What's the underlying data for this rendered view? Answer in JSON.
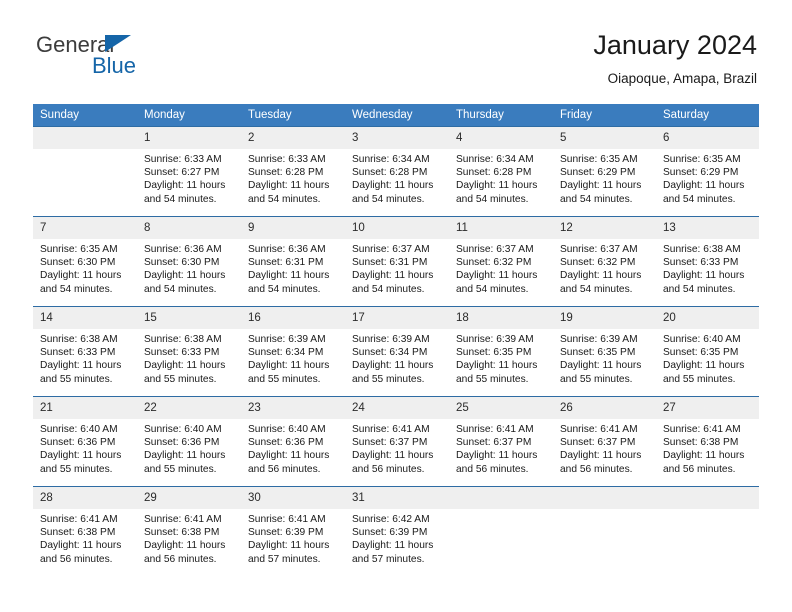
{
  "brand": {
    "name_part1": "General",
    "name_part2": "Blue",
    "logo_icon": "triangle-icon"
  },
  "header": {
    "title": "January 2024",
    "subtitle": "Oiapoque, Amapa, Brazil"
  },
  "calendar": {
    "weekday_headers": [
      "Sunday",
      "Monday",
      "Tuesday",
      "Wednesday",
      "Thursday",
      "Friday",
      "Saturday"
    ],
    "accent_color": "#3a7cbe",
    "daynum_bg_color": "#efefef",
    "row_border_color": "#2e6ca4",
    "weeks": [
      [
        {
          "day": "",
          "lines": []
        },
        {
          "day": "1",
          "lines": [
            "Sunrise: 6:33 AM",
            "Sunset: 6:27 PM",
            "Daylight: 11 hours and 54 minutes."
          ]
        },
        {
          "day": "2",
          "lines": [
            "Sunrise: 6:33 AM",
            "Sunset: 6:28 PM",
            "Daylight: 11 hours and 54 minutes."
          ]
        },
        {
          "day": "3",
          "lines": [
            "Sunrise: 6:34 AM",
            "Sunset: 6:28 PM",
            "Daylight: 11 hours and 54 minutes."
          ]
        },
        {
          "day": "4",
          "lines": [
            "Sunrise: 6:34 AM",
            "Sunset: 6:28 PM",
            "Daylight: 11 hours and 54 minutes."
          ]
        },
        {
          "day": "5",
          "lines": [
            "Sunrise: 6:35 AM",
            "Sunset: 6:29 PM",
            "Daylight: 11 hours and 54 minutes."
          ]
        },
        {
          "day": "6",
          "lines": [
            "Sunrise: 6:35 AM",
            "Sunset: 6:29 PM",
            "Daylight: 11 hours and 54 minutes."
          ]
        }
      ],
      [
        {
          "day": "7",
          "lines": [
            "Sunrise: 6:35 AM",
            "Sunset: 6:30 PM",
            "Daylight: 11 hours and 54 minutes."
          ]
        },
        {
          "day": "8",
          "lines": [
            "Sunrise: 6:36 AM",
            "Sunset: 6:30 PM",
            "Daylight: 11 hours and 54 minutes."
          ]
        },
        {
          "day": "9",
          "lines": [
            "Sunrise: 6:36 AM",
            "Sunset: 6:31 PM",
            "Daylight: 11 hours and 54 minutes."
          ]
        },
        {
          "day": "10",
          "lines": [
            "Sunrise: 6:37 AM",
            "Sunset: 6:31 PM",
            "Daylight: 11 hours and 54 minutes."
          ]
        },
        {
          "day": "11",
          "lines": [
            "Sunrise: 6:37 AM",
            "Sunset: 6:32 PM",
            "Daylight: 11 hours and 54 minutes."
          ]
        },
        {
          "day": "12",
          "lines": [
            "Sunrise: 6:37 AM",
            "Sunset: 6:32 PM",
            "Daylight: 11 hours and 54 minutes."
          ]
        },
        {
          "day": "13",
          "lines": [
            "Sunrise: 6:38 AM",
            "Sunset: 6:33 PM",
            "Daylight: 11 hours and 54 minutes."
          ]
        }
      ],
      [
        {
          "day": "14",
          "lines": [
            "Sunrise: 6:38 AM",
            "Sunset: 6:33 PM",
            "Daylight: 11 hours and 55 minutes."
          ]
        },
        {
          "day": "15",
          "lines": [
            "Sunrise: 6:38 AM",
            "Sunset: 6:33 PM",
            "Daylight: 11 hours and 55 minutes."
          ]
        },
        {
          "day": "16",
          "lines": [
            "Sunrise: 6:39 AM",
            "Sunset: 6:34 PM",
            "Daylight: 11 hours and 55 minutes."
          ]
        },
        {
          "day": "17",
          "lines": [
            "Sunrise: 6:39 AM",
            "Sunset: 6:34 PM",
            "Daylight: 11 hours and 55 minutes."
          ]
        },
        {
          "day": "18",
          "lines": [
            "Sunrise: 6:39 AM",
            "Sunset: 6:35 PM",
            "Daylight: 11 hours and 55 minutes."
          ]
        },
        {
          "day": "19",
          "lines": [
            "Sunrise: 6:39 AM",
            "Sunset: 6:35 PM",
            "Daylight: 11 hours and 55 minutes."
          ]
        },
        {
          "day": "20",
          "lines": [
            "Sunrise: 6:40 AM",
            "Sunset: 6:35 PM",
            "Daylight: 11 hours and 55 minutes."
          ]
        }
      ],
      [
        {
          "day": "21",
          "lines": [
            "Sunrise: 6:40 AM",
            "Sunset: 6:36 PM",
            "Daylight: 11 hours and 55 minutes."
          ]
        },
        {
          "day": "22",
          "lines": [
            "Sunrise: 6:40 AM",
            "Sunset: 6:36 PM",
            "Daylight: 11 hours and 55 minutes."
          ]
        },
        {
          "day": "23",
          "lines": [
            "Sunrise: 6:40 AM",
            "Sunset: 6:36 PM",
            "Daylight: 11 hours and 56 minutes."
          ]
        },
        {
          "day": "24",
          "lines": [
            "Sunrise: 6:41 AM",
            "Sunset: 6:37 PM",
            "Daylight: 11 hours and 56 minutes."
          ]
        },
        {
          "day": "25",
          "lines": [
            "Sunrise: 6:41 AM",
            "Sunset: 6:37 PM",
            "Daylight: 11 hours and 56 minutes."
          ]
        },
        {
          "day": "26",
          "lines": [
            "Sunrise: 6:41 AM",
            "Sunset: 6:37 PM",
            "Daylight: 11 hours and 56 minutes."
          ]
        },
        {
          "day": "27",
          "lines": [
            "Sunrise: 6:41 AM",
            "Sunset: 6:38 PM",
            "Daylight: 11 hours and 56 minutes."
          ]
        }
      ],
      [
        {
          "day": "28",
          "lines": [
            "Sunrise: 6:41 AM",
            "Sunset: 6:38 PM",
            "Daylight: 11 hours and 56 minutes."
          ]
        },
        {
          "day": "29",
          "lines": [
            "Sunrise: 6:41 AM",
            "Sunset: 6:38 PM",
            "Daylight: 11 hours and 56 minutes."
          ]
        },
        {
          "day": "30",
          "lines": [
            "Sunrise: 6:41 AM",
            "Sunset: 6:39 PM",
            "Daylight: 11 hours and 57 minutes."
          ]
        },
        {
          "day": "31",
          "lines": [
            "Sunrise: 6:42 AM",
            "Sunset: 6:39 PM",
            "Daylight: 11 hours and 57 minutes."
          ]
        },
        {
          "day": "",
          "lines": []
        },
        {
          "day": "",
          "lines": []
        },
        {
          "day": "",
          "lines": []
        }
      ]
    ]
  }
}
